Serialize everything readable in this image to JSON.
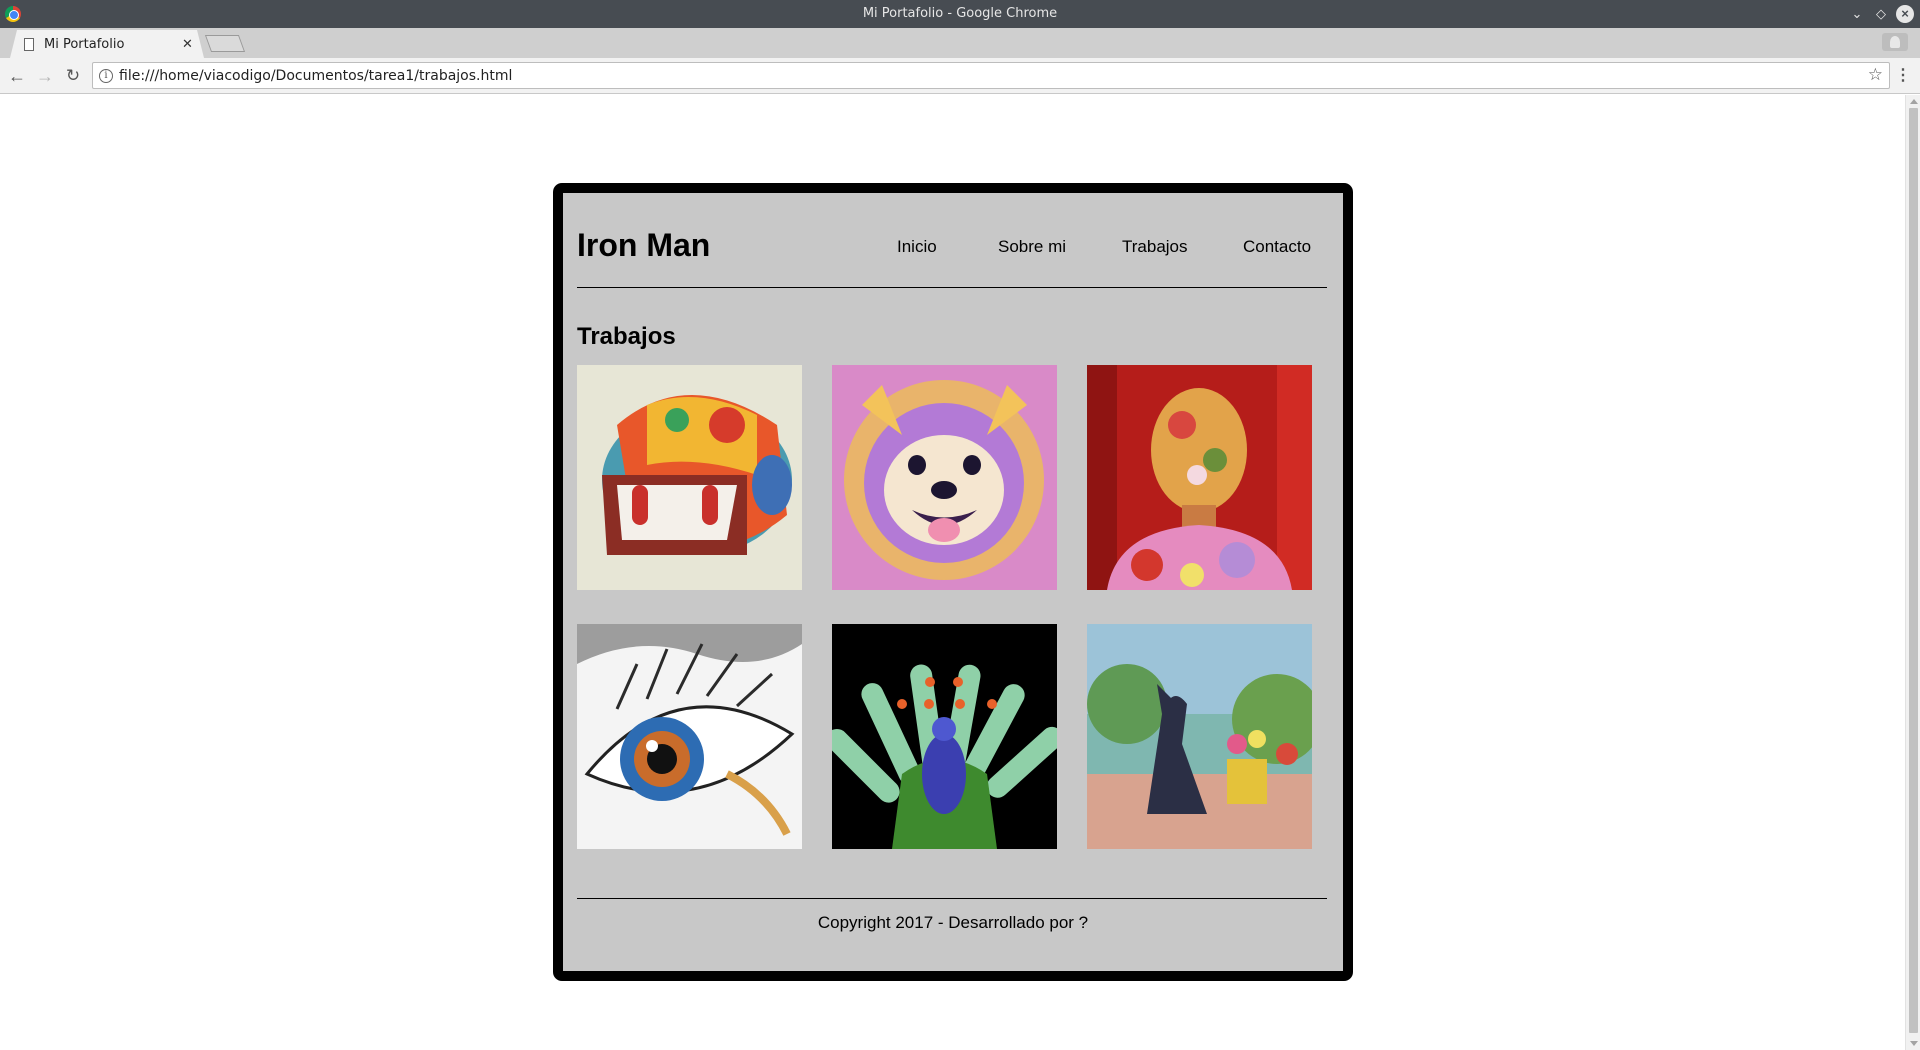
{
  "window": {
    "title": "Mi Portafolio - Google Chrome"
  },
  "tabs": [
    {
      "label": "Mi Portafolio"
    }
  ],
  "toolbar": {
    "url": "file:///home/viacodigo/Documentos/tarea1/trabajos.html"
  },
  "page": {
    "site_title": "Iron Man",
    "nav": [
      "Inicio",
      "Sobre mi",
      "Trabajos",
      "Contacto"
    ],
    "section_title": "Trabajos",
    "footer": "Copyright 2017 - Desarrollado por ?"
  },
  "colors": {
    "page_background": "#c8c8c8",
    "frame_border": "#000000",
    "titlebar": "#474c52"
  }
}
